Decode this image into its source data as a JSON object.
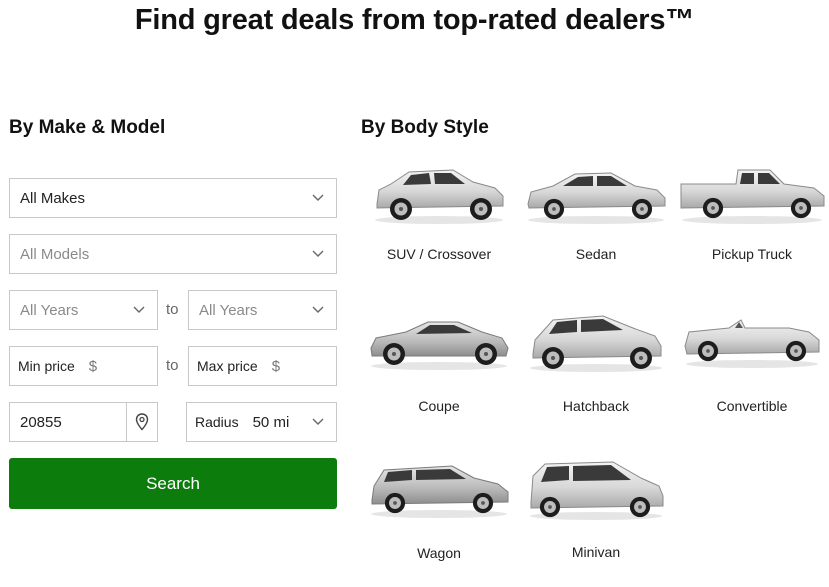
{
  "headline": "Find great deals from top-rated dealers™",
  "make_model": {
    "title": "By Make & Model",
    "makes": "All Makes",
    "models": "All Models",
    "year_from": "All Years",
    "year_to": "All Years",
    "to_word_1": "to",
    "to_word_2": "to",
    "min_price_label": "Min price",
    "max_price_label": "Max price",
    "currency_symbol": "$",
    "zip": "20855",
    "radius_label": "Radius",
    "radius_value": "50 mi",
    "search_label": "Search"
  },
  "body_style": {
    "title": "By Body Style",
    "items": [
      {
        "label": "SUV / Crossover",
        "icon": "suv-icon"
      },
      {
        "label": "Sedan",
        "icon": "sedan-icon"
      },
      {
        "label": "Pickup Truck",
        "icon": "pickup-truck-icon"
      },
      {
        "label": "Coupe",
        "icon": "coupe-icon"
      },
      {
        "label": "Hatchback",
        "icon": "hatchback-icon"
      },
      {
        "label": "Convertible",
        "icon": "convertible-icon"
      },
      {
        "label": "Wagon",
        "icon": "wagon-icon"
      },
      {
        "label": "Minivan",
        "icon": "minivan-icon"
      }
    ]
  },
  "colors": {
    "search_button": "#0c7c0c",
    "border": "#c9c9c9"
  }
}
